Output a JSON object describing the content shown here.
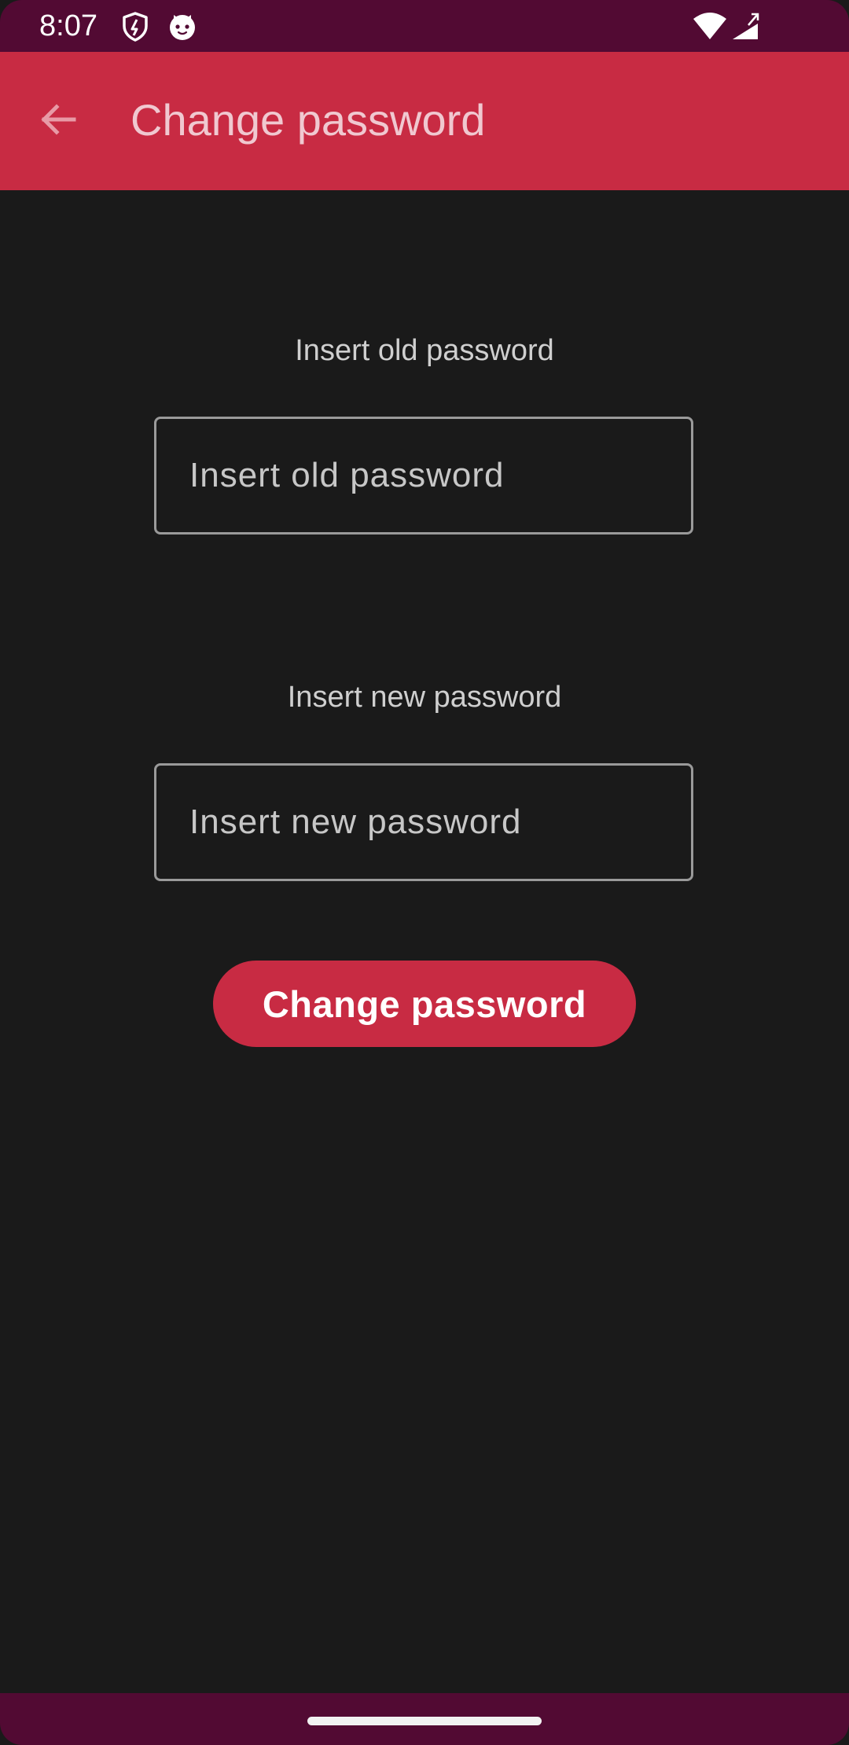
{
  "status_bar": {
    "time": "8:07",
    "icons": [
      "shield-icon",
      "cat-face-icon",
      "wifi-icon",
      "signal-icon"
    ]
  },
  "app_bar": {
    "title": "Change password",
    "back_icon": "arrow-left-icon"
  },
  "form": {
    "old_password": {
      "label": "Insert old password",
      "placeholder": "Insert old password",
      "value": ""
    },
    "new_password": {
      "label": "Insert new password",
      "placeholder": "Insert new password",
      "value": ""
    },
    "submit_label": "Change password"
  },
  "colors": {
    "status_bar": "#520a33",
    "app_bar": "#c82b43",
    "background": "#1a1a1a",
    "title_text": "#f0c8d0",
    "accent": "#c82b43"
  }
}
